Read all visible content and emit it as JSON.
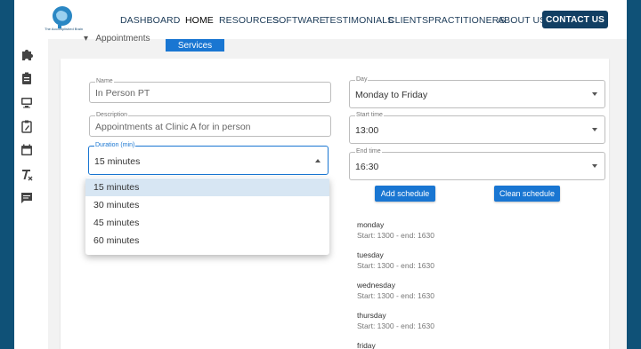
{
  "nav": {
    "logo_alt": "The Accomplished Brain",
    "items": [
      "DASHBOARD",
      "HOME",
      "RESOURCES",
      "SOFTWARE",
      "TESTIMONIALS",
      "CLIENTS",
      "PRACTITIONERS",
      "ABOUT US"
    ],
    "contact": "CONTACT US"
  },
  "tabs": {
    "appointments": "Appointments",
    "services": "Services"
  },
  "form": {
    "name": {
      "label": "Name",
      "value": "In Person PT"
    },
    "description": {
      "label": "Description",
      "value": "Appointments at Clinic A for in person"
    },
    "duration": {
      "label": "Duration (min)",
      "value": "15 minutes"
    },
    "day": {
      "label": "Day",
      "value": "Monday to Friday"
    },
    "start": {
      "label": "Start time",
      "value": "13:00"
    },
    "end": {
      "label": "End time",
      "value": "16:30"
    },
    "add_btn": "Add schedule",
    "clean_btn": "Clean schedule"
  },
  "duration_options": [
    "15 minutes",
    "30 minutes",
    "45 minutes",
    "60 minutes"
  ],
  "schedule": [
    {
      "day": "monday",
      "time": "Start: 1300 - end: 1630"
    },
    {
      "day": "tuesday",
      "time": "Start: 1300 - end: 1630"
    },
    {
      "day": "wednesday",
      "time": "Start: 1300 - end: 1630"
    },
    {
      "day": "thursday",
      "time": "Start: 1300 - end: 1630"
    },
    {
      "day": "friday",
      "time": ""
    }
  ],
  "colors": {
    "brand": "#123f63",
    "accent": "#1976d2",
    "bg": "#0f5177"
  }
}
